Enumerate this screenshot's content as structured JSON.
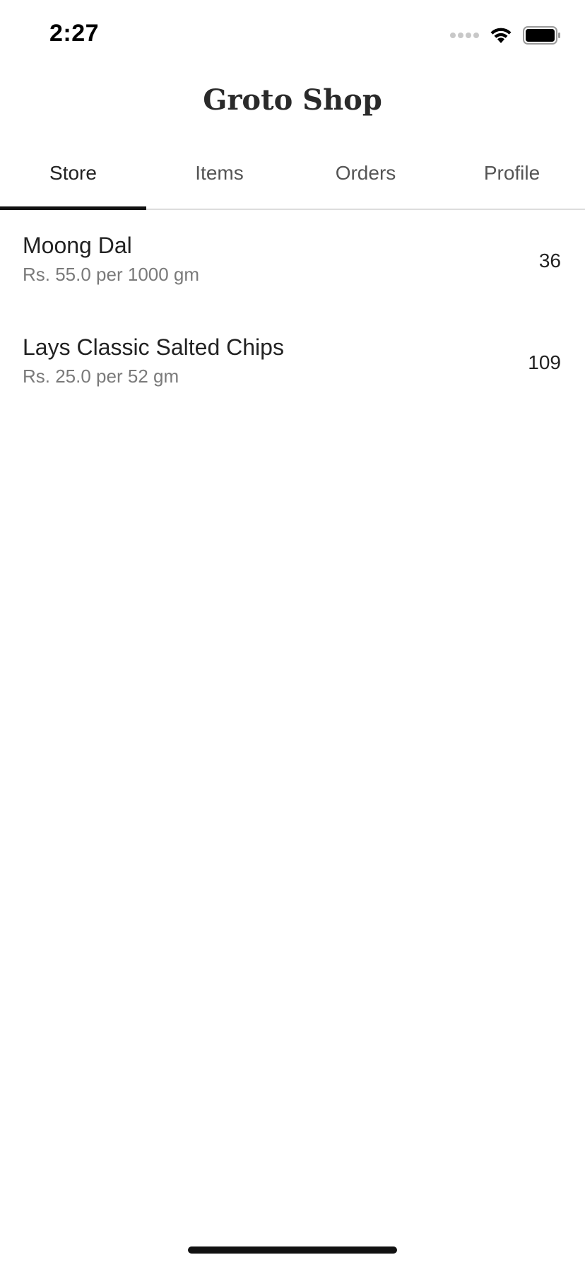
{
  "status_bar": {
    "time": "2:27",
    "icons": [
      "signal-dots-icon",
      "wifi-icon",
      "battery-icon"
    ]
  },
  "app": {
    "title": "Groto Shop"
  },
  "tabs": [
    {
      "label": "Store",
      "active": true
    },
    {
      "label": "Items",
      "active": false
    },
    {
      "label": "Orders",
      "active": false
    },
    {
      "label": "Profile",
      "active": false
    }
  ],
  "items": [
    {
      "name": "Moong Dal",
      "price": "Rs. 55.0 per 1000 gm",
      "quantity": "36"
    },
    {
      "name": "Lays Classic Salted Chips",
      "price": "Rs. 25.0 per 52 gm",
      "quantity": "109"
    }
  ],
  "colors": {
    "active_tab_indicator": "#111111",
    "secondary_text": "#7a7a7a",
    "primary_text": "#222222"
  }
}
